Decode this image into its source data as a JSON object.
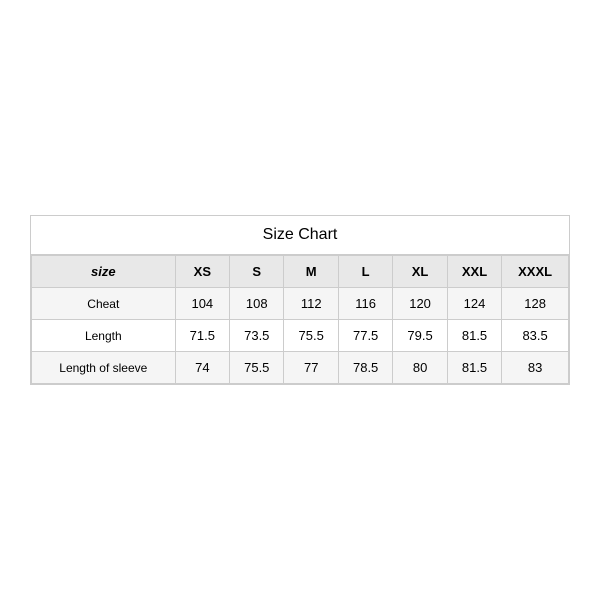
{
  "chart": {
    "title": "Size Chart",
    "headers": [
      "size",
      "XS",
      "S",
      "M",
      "L",
      "XL",
      "XXL",
      "XXXL"
    ],
    "rows": [
      {
        "label": "Cheat",
        "values": [
          "104",
          "108",
          "112",
          "116",
          "120",
          "124",
          "128"
        ]
      },
      {
        "label": "Length",
        "values": [
          "71.5",
          "73.5",
          "75.5",
          "77.5",
          "79.5",
          "81.5",
          "83.5"
        ]
      },
      {
        "label": "Length of sleeve",
        "values": [
          "74",
          "75.5",
          "77",
          "78.5",
          "80",
          "81.5",
          "83"
        ]
      }
    ]
  }
}
